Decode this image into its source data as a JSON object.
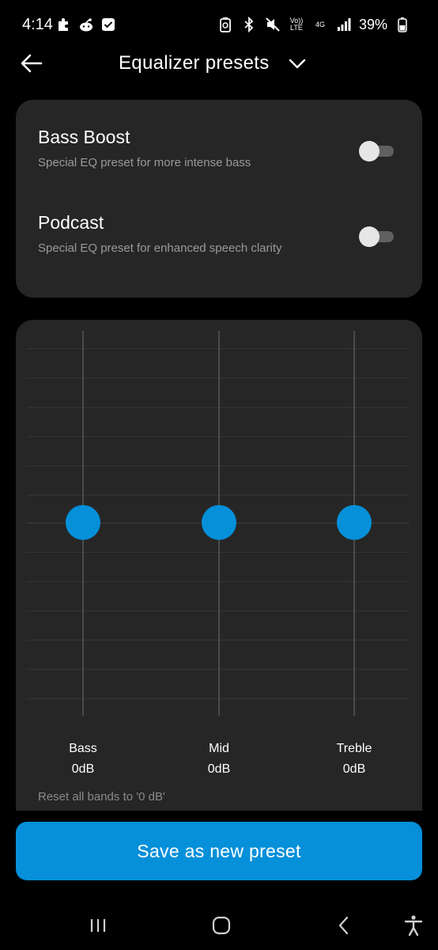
{
  "status_bar": {
    "time": "4:14",
    "battery": "39%",
    "volte": "Vo)) LTE",
    "network": "4G"
  },
  "header": {
    "title": "Equalizer presets"
  },
  "presets": [
    {
      "title": "Bass Boost",
      "subtitle": "Special EQ preset for more intense bass",
      "enabled": false
    },
    {
      "title": "Podcast",
      "subtitle": "Special EQ preset for enhanced speech clarity",
      "enabled": false
    }
  ],
  "equalizer": {
    "bands": [
      {
        "label": "Bass",
        "value": "0dB"
      },
      {
        "label": "Mid",
        "value": "0dB"
      },
      {
        "label": "Treble",
        "value": "0dB"
      }
    ],
    "reset_label": "Reset all bands to '0 dB'",
    "accent_color": "#0590d9"
  },
  "save_button": {
    "label": "Save as new preset"
  },
  "nav_bar": {
    "icons": [
      "recent-apps-icon",
      "home-icon",
      "back-icon",
      "accessibility-icon"
    ]
  }
}
